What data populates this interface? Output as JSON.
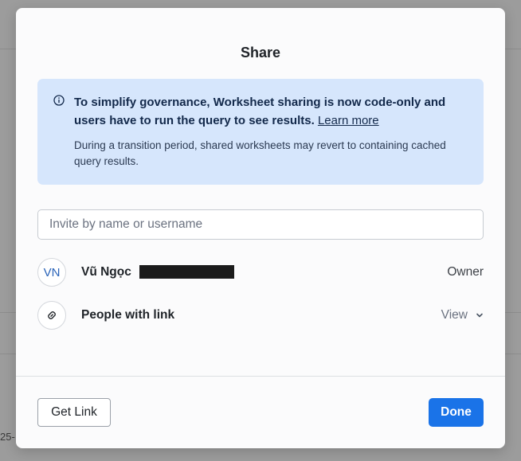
{
  "background": {
    "partial_text": "25-"
  },
  "dialog": {
    "title": "Share",
    "notice": {
      "icon": "info-icon",
      "headline": "To simplify governance, Worksheet sharing is now code-only and users have to run the query to see results.",
      "link_label": "Learn more",
      "body": "During a transition period, shared worksheets may revert to containing cached query results."
    },
    "invite": {
      "placeholder": "Invite by name or username",
      "value": ""
    },
    "members": [
      {
        "avatar_initials": "VN",
        "name": "Vũ Ngọc",
        "role": "Owner"
      }
    ],
    "link_access": {
      "icon": "link-icon",
      "label": "People with link",
      "permission": "View"
    },
    "footer": {
      "get_link_label": "Get Link",
      "done_label": "Done"
    }
  },
  "colors": {
    "accent": "#1a73e8",
    "notice_bg": "#d6e6fc",
    "notice_text": "#13294b"
  }
}
